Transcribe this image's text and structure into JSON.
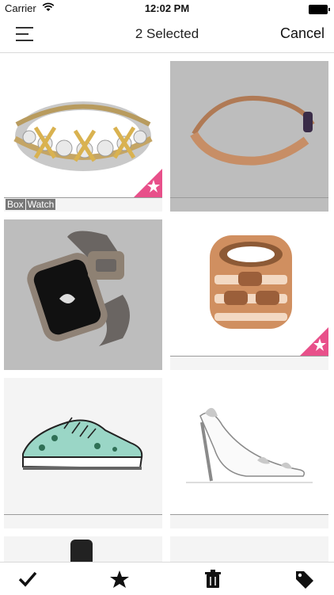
{
  "status_bar": {
    "carrier": "Carrier",
    "time": "12:02 PM"
  },
  "nav": {
    "title": "2 Selected",
    "cancel_label": "Cancel"
  },
  "items": [
    {
      "product": "diamond-ring-gold",
      "selected": false,
      "favorite": true,
      "tag": [
        "Box",
        "Watch"
      ]
    },
    {
      "product": "rose-gold-bracelet",
      "selected": true,
      "favorite": false
    },
    {
      "product": "smart-watch",
      "selected": true,
      "favorite": false
    },
    {
      "product": "rose-gold-ring",
      "selected": false,
      "favorite": true
    },
    {
      "product": "sneaker",
      "selected": false,
      "favorite": false
    },
    {
      "product": "white-heel",
      "selected": false,
      "favorite": false
    }
  ],
  "colors": {
    "accent": "#e8508a",
    "selected_overlay": "#bdbdbd"
  },
  "tabbar": {
    "icons": [
      "checkmark-icon",
      "star-icon",
      "trash-icon",
      "tag-icon"
    ]
  }
}
